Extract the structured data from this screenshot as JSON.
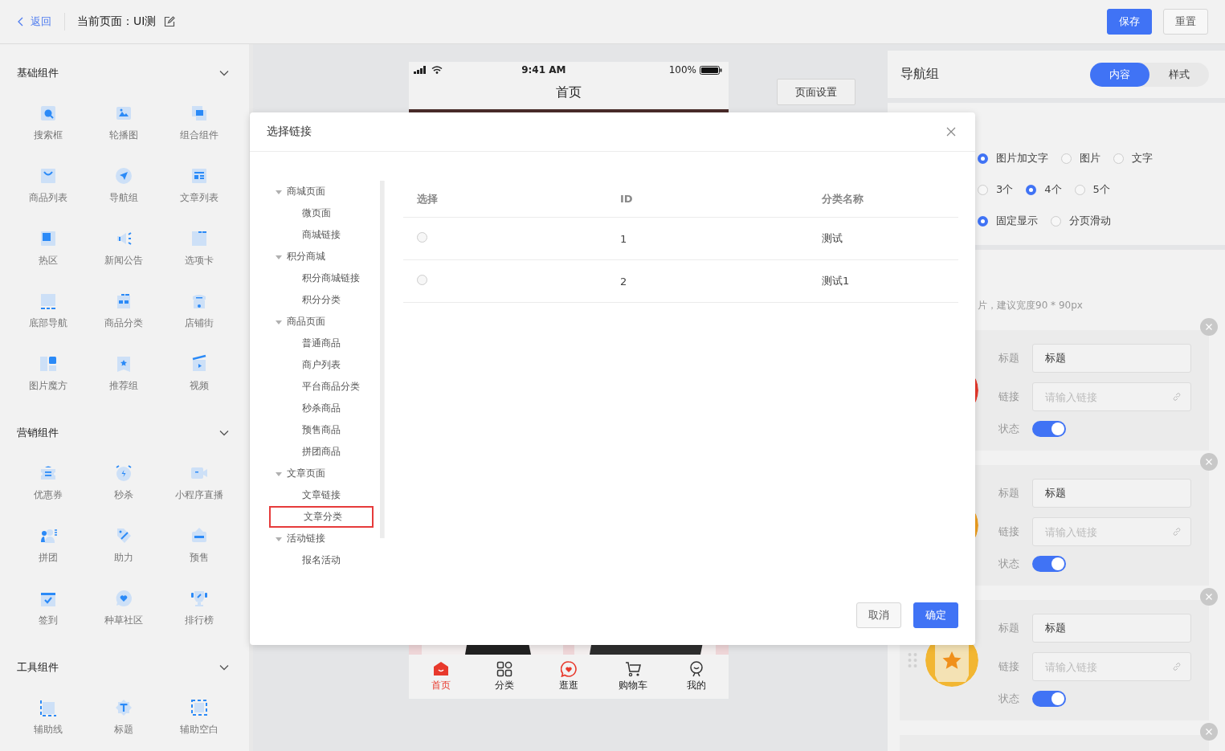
{
  "header": {
    "back": "返回",
    "page_title": "当前页面：UI测",
    "buttons": [
      {
        "label": "保存",
        "kind": "primary"
      },
      {
        "label": "重置",
        "kind": "default"
      }
    ]
  },
  "sidebar": {
    "sections": [
      {
        "title": "基础组件",
        "expanded": true,
        "items": [
          "搜索框",
          "轮播图",
          "组合组件",
          "商品列表",
          "导航组",
          "文章列表",
          "热区",
          "新闻公告",
          "选项卡",
          "底部导航",
          "商品分类",
          "店铺街",
          "图片魔方",
          "推荐组",
          "视频"
        ]
      },
      {
        "title": "营销组件",
        "expanded": true,
        "items": [
          "优惠券",
          "秒杀",
          "小程序直播",
          "拼团",
          "助力",
          "预售",
          "签到",
          "种草社区",
          "排行榜"
        ]
      },
      {
        "title": "工具组件",
        "expanded": true,
        "items": [
          "辅助线",
          "标题",
          "辅助空白"
        ]
      }
    ]
  },
  "phone": {
    "time": "9:41 AM",
    "battery": "100%",
    "title": "首页",
    "tabs": [
      {
        "label": "首页",
        "selected": true
      },
      {
        "label": "分类",
        "selected": false
      },
      {
        "label": "逛逛",
        "selected": false
      },
      {
        "label": "购物车",
        "selected": false
      },
      {
        "label": "我的",
        "selected": false
      }
    ]
  },
  "page_settings_button": "页面设置",
  "panel": {
    "title": "导航组",
    "tabs": [
      {
        "label": "内容",
        "selected": true
      },
      {
        "label": "样式",
        "selected": false
      }
    ],
    "option_groups": [
      [
        {
          "label": "图片加文字",
          "selected": true
        },
        {
          "label": "图片",
          "selected": false
        },
        {
          "label": "文字",
          "selected": false
        }
      ],
      [
        {
          "label": "3个",
          "selected": false
        },
        {
          "label": "4个",
          "selected": true
        },
        {
          "label": "5个",
          "selected": false
        }
      ],
      [
        {
          "label": "固定显示",
          "selected": true
        },
        {
          "label": "分页滑动",
          "selected": false
        }
      ]
    ],
    "hint": "片，建议宽度90 * 90px",
    "nav_items": [
      {
        "kind": "full",
        "color": "#e8392c",
        "title_label": "标题",
        "title_value": "标题",
        "link_label": "链接",
        "link_placeholder": "请输入链接",
        "status_label": "状态",
        "on": true
      },
      {
        "kind": "full",
        "color": "#f0a020",
        "title_label": "标题",
        "title_value": "标题",
        "link_label": "链接",
        "link_placeholder": "请输入链接",
        "status_label": "状态",
        "on": true
      },
      {
        "kind": "full",
        "drag_handle": true,
        "color": "#f2b632",
        "title_label": "标题",
        "title_value": "标题",
        "link_label": "链接",
        "link_placeholder": "请输入链接",
        "status_label": "状态",
        "on": true
      },
      {
        "kind": "cut"
      }
    ]
  },
  "dialog": {
    "title": "选择链接",
    "tree": [
      {
        "label": "商城页面",
        "expanded": true,
        "selected": false,
        "children": [
          {
            "label": "微页面",
            "selected": false
          },
          {
            "label": "商城链接",
            "selected": false
          }
        ]
      },
      {
        "label": "积分商城",
        "expanded": true,
        "selected": false,
        "children": [
          {
            "label": "积分商城链接",
            "selected": false
          },
          {
            "label": "积分分类",
            "selected": false
          }
        ]
      },
      {
        "label": "商品页面",
        "expanded": true,
        "selected": false,
        "children": [
          {
            "label": "普通商品",
            "selected": false
          },
          {
            "label": "商户列表",
            "selected": false
          },
          {
            "label": "平台商品分类",
            "selected": false
          },
          {
            "label": "秒杀商品",
            "selected": false
          },
          {
            "label": "预售商品",
            "selected": false
          },
          {
            "label": "拼团商品",
            "selected": false
          }
        ]
      },
      {
        "label": "文章页面",
        "expanded": true,
        "selected": false,
        "children": [
          {
            "label": "文章链接",
            "selected": false
          },
          {
            "label": "文章分类",
            "selected": true
          }
        ]
      },
      {
        "label": "活动链接",
        "expanded": true,
        "selected": false,
        "children": [
          {
            "label": "报名活动",
            "selected": false
          }
        ]
      }
    ],
    "table": {
      "columns": [
        "选择",
        "ID",
        "分类名称"
      ],
      "rows": [
        {
          "selected": false,
          "id": "1",
          "name": "测试"
        },
        {
          "selected": false,
          "id": "2",
          "name": "测试1"
        }
      ]
    },
    "buttons": [
      {
        "label": "取消",
        "kind": "default"
      },
      {
        "label": "确定",
        "kind": "primary"
      }
    ]
  }
}
